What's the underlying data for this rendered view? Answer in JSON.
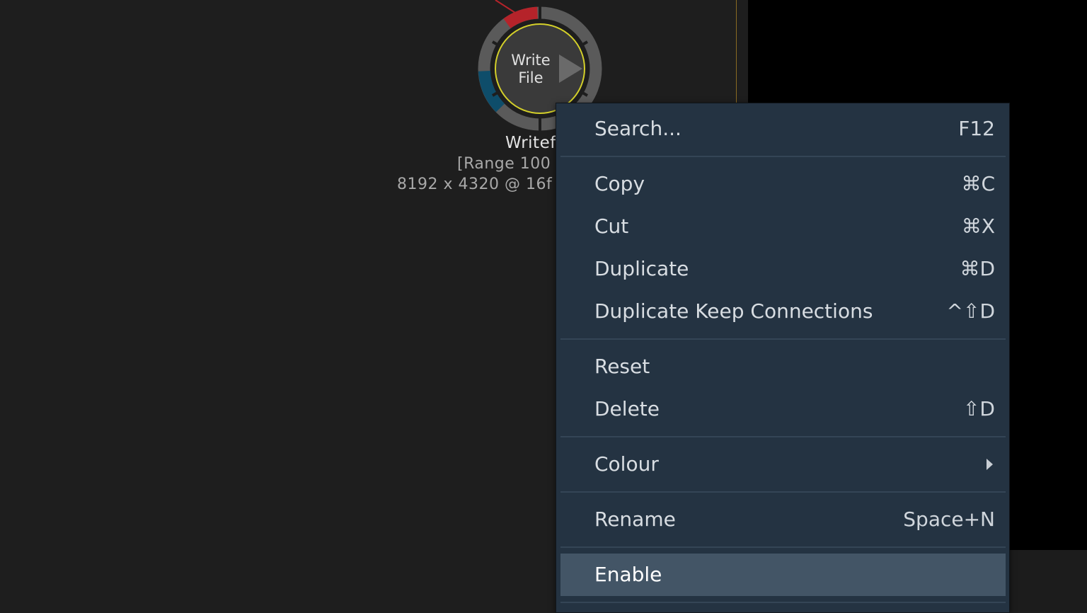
{
  "node": {
    "title_line1": "Write",
    "title_line2": "File",
    "name": "Writef",
    "range": "[Range  100",
    "format": "8192 x 4320 @ 16f"
  },
  "context_menu": {
    "items": [
      {
        "label": "Search...",
        "shortcut": "F12"
      },
      {
        "label": "Copy",
        "shortcut": "⌘C"
      },
      {
        "label": "Cut",
        "shortcut": "⌘X"
      },
      {
        "label": "Duplicate",
        "shortcut": "⌘D"
      },
      {
        "label": "Duplicate Keep Connections",
        "shortcut": "^⇧D"
      },
      {
        "label": "Reset",
        "shortcut": ""
      },
      {
        "label": "Delete",
        "shortcut": "⇧D"
      },
      {
        "label": "Colour",
        "shortcut": "",
        "submenu": true,
        "icon": "submenu-arrow-icon"
      },
      {
        "label": "Rename",
        "shortcut": "Space+N"
      },
      {
        "label": "Enable",
        "shortcut": "",
        "highlighted": true
      }
    ]
  },
  "colors": {
    "canvas_bg": "#1e1e1e",
    "menu_bg": "#243342",
    "menu_highlight": "#435566",
    "node_ring": "#5a5a5a",
    "node_red": "#b5232a",
    "node_blue": "#0e4d6a",
    "node_select": "#d4d02a",
    "node_fill": "#3a3a3a"
  }
}
